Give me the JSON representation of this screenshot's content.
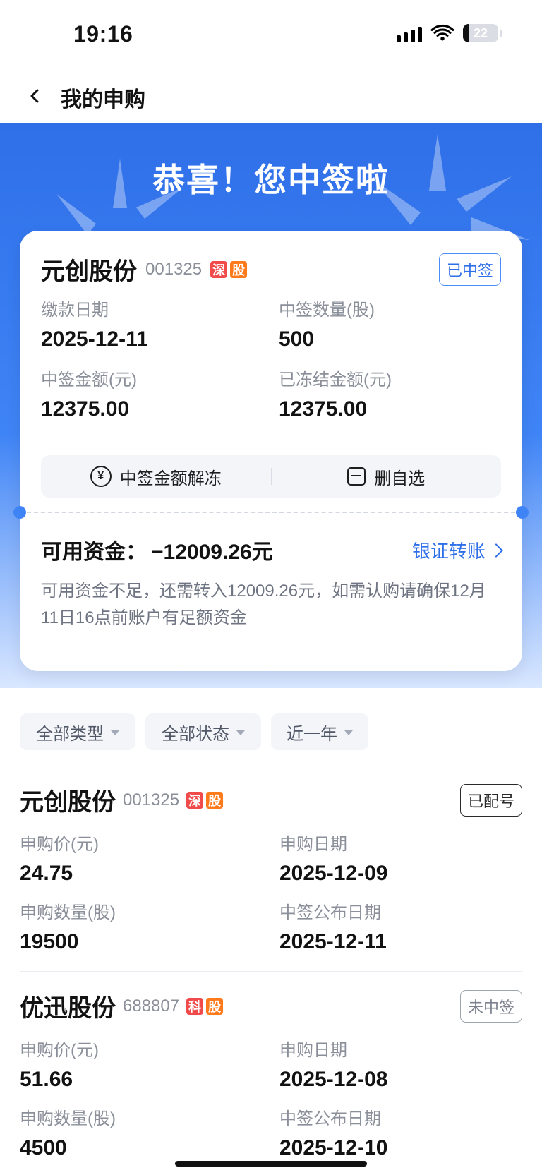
{
  "status_bar": {
    "time": "19:16",
    "battery": "22",
    "icons": [
      "signal-icon",
      "wifi-icon",
      "battery-icon"
    ]
  },
  "nav": {
    "title": "我的申购",
    "back_icon": "back-chevron-icon"
  },
  "hero": {
    "title": "恭喜！您中签啦"
  },
  "win_card": {
    "stock_name": "元创股份",
    "code": "001325",
    "tags": [
      "深",
      "股"
    ],
    "status": "已中签",
    "fields": [
      {
        "label": "缴款日期",
        "value": "2025-12-11"
      },
      {
        "label": "中签数量(股)",
        "value": "500"
      },
      {
        "label": "中签金额(元)",
        "value": "12375.00"
      },
      {
        "label": "已冻结金额(元)",
        "value": "12375.00"
      }
    ],
    "actions": [
      {
        "label": "中签金额解冻",
        "icon": "yen-circle-icon"
      },
      {
        "label": "删自选",
        "icon": "minus-square-icon"
      }
    ],
    "funds_label": "可用资金：",
    "funds_value": "−12009.26元",
    "transfer_label": "银证转账",
    "note": "可用资金不足，还需转入12009.26元，如需认购请确保12月11日16点前账户有足额资金"
  },
  "filters": [
    {
      "label": "全部类型"
    },
    {
      "label": "全部状态"
    },
    {
      "label": "近一年"
    }
  ],
  "list": [
    {
      "stock_name": "元创股份",
      "code": "001325",
      "tags": [
        "深",
        "股"
      ],
      "status": "已配号",
      "fields": [
        {
          "label": "申购价(元)",
          "value": "24.75"
        },
        {
          "label": "申购日期",
          "value": "2025-12-09"
        },
        {
          "label": "申购数量(股)",
          "value": "19500"
        },
        {
          "label": "中签公布日期",
          "value": "2025-12-11"
        }
      ]
    },
    {
      "stock_name": "优迅股份",
      "code": "688807",
      "tags": [
        "科",
        "股"
      ],
      "status": "未中签",
      "fields": [
        {
          "label": "申购价(元)",
          "value": "51.66"
        },
        {
          "label": "申购日期",
          "value": "2025-12-08"
        },
        {
          "label": "申购数量(股)",
          "value": "4500"
        },
        {
          "label": "中签公布日期",
          "value": "2025-12-10"
        }
      ]
    }
  ]
}
